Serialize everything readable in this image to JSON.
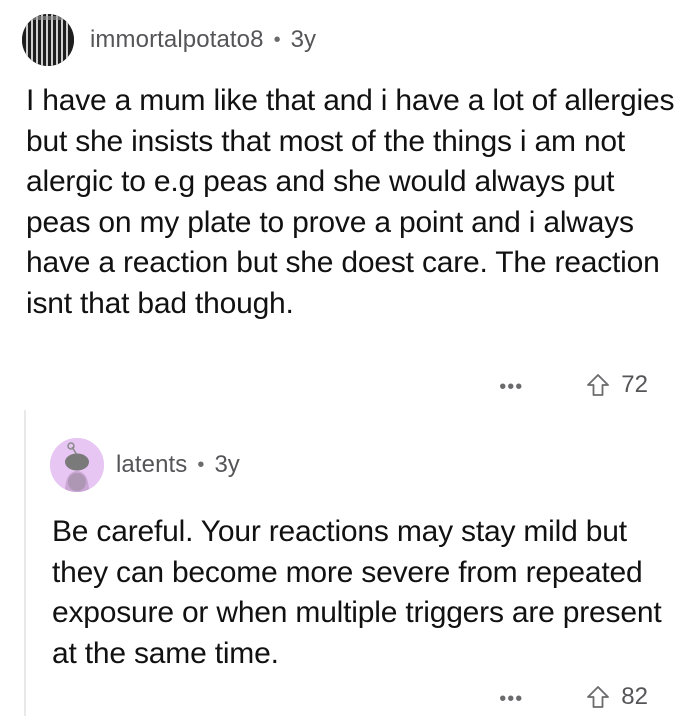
{
  "comments": [
    {
      "username": "immortalpotato8",
      "separator": "•",
      "age": "3y",
      "avatar_icon": "striped-avatar-icon",
      "text": "I have a mum like that and i have a lot of allergies but she insists that most of the things i am not alergic to e.g peas and she would always put peas on my plate to prove a point and i always have a reaction but she doest care. The reaction isnt that bad though.",
      "more_label": "•••",
      "upvote_icon": "upvote-arrow-icon",
      "votes": "72"
    },
    {
      "username": "latents",
      "separator": "•",
      "age": "3y",
      "avatar_icon": "snoo-avatar-icon",
      "text": "Be careful. Your reactions may stay mild but they can become more severe from repeated exposure or when multiple triggers are present at the same time.",
      "more_label": "•••",
      "upvote_icon": "upvote-arrow-icon",
      "votes": "82"
    }
  ],
  "colors": {
    "text": "#111111",
    "meta": "#555558",
    "thread_line": "#e9e9ea",
    "reply_avatar_bg": "#e7c6f3"
  }
}
